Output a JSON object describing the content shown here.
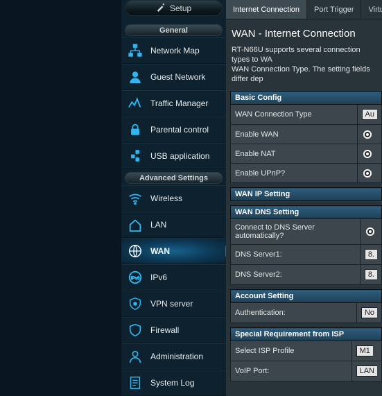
{
  "setup": {
    "label": "Setup"
  },
  "sections": {
    "general": {
      "title": "General",
      "items": [
        {
          "id": "network-map",
          "label": "Network Map",
          "icon": "network-map-icon"
        },
        {
          "id": "guest-network",
          "label": "Guest Network",
          "icon": "guest-network-icon"
        },
        {
          "id": "traffic-manager",
          "label": "Traffic Manager",
          "icon": "traffic-manager-icon"
        },
        {
          "id": "parental-control",
          "label": "Parental control",
          "icon": "parental-control-icon"
        },
        {
          "id": "usb-application",
          "label": "USB application",
          "icon": "usb-application-icon"
        }
      ]
    },
    "advanced": {
      "title": "Advanced Settings",
      "items": [
        {
          "id": "wireless",
          "label": "Wireless",
          "icon": "wireless-icon"
        },
        {
          "id": "lan",
          "label": "LAN",
          "icon": "lan-icon"
        },
        {
          "id": "wan",
          "label": "WAN",
          "icon": "wan-icon",
          "active": true
        },
        {
          "id": "ipv6",
          "label": "IPv6",
          "icon": "ipv6-icon"
        },
        {
          "id": "vpn-server",
          "label": "VPN server",
          "icon": "vpn-server-icon"
        },
        {
          "id": "firewall",
          "label": "Firewall",
          "icon": "firewall-icon"
        },
        {
          "id": "administration",
          "label": "Administration",
          "icon": "administration-icon"
        },
        {
          "id": "system-log",
          "label": "System Log",
          "icon": "system-log-icon"
        }
      ]
    }
  },
  "tabs": [
    {
      "id": "internet-connection",
      "label": "Internet Connection",
      "active": true
    },
    {
      "id": "port-trigger",
      "label": "Port Trigger"
    },
    {
      "id": "virtual",
      "label": "Virtual"
    }
  ],
  "page": {
    "title": "WAN - Internet Connection",
    "desc1": "RT-N66U supports several connection types to WA",
    "desc2": "WAN Connection Type. The setting fields differ dep"
  },
  "groups": {
    "basic": {
      "title": "Basic Config",
      "rows": {
        "wan_conn_type": {
          "label": "WAN Connection Type",
          "value": "Au"
        },
        "enable_wan": {
          "label": "Enable WAN",
          "value": "yes"
        },
        "enable_nat": {
          "label": "Enable NAT",
          "value": "yes"
        },
        "enable_upnp": {
          "label": "Enable UPnP?",
          "value": "yes"
        }
      }
    },
    "wan_ip": {
      "title": "WAN IP Setting"
    },
    "wan_dns": {
      "title": "WAN DNS Setting",
      "rows": {
        "auto_dns": {
          "label": "Connect to DNS Server automatically?",
          "value": "yes"
        },
        "dns1": {
          "label": "DNS Server1:",
          "value": "8."
        },
        "dns2": {
          "label": "DNS Server2:",
          "value": "8."
        }
      }
    },
    "account": {
      "title": "Account Setting",
      "rows": {
        "auth": {
          "label": "Authentication:",
          "value": "No"
        }
      }
    },
    "isp": {
      "title": "Special Requirement from ISP",
      "rows": {
        "profile": {
          "label": "Select ISP Profile",
          "value": "M1"
        },
        "voip": {
          "label": "VoIP Port:",
          "value": "LAN"
        }
      }
    }
  }
}
